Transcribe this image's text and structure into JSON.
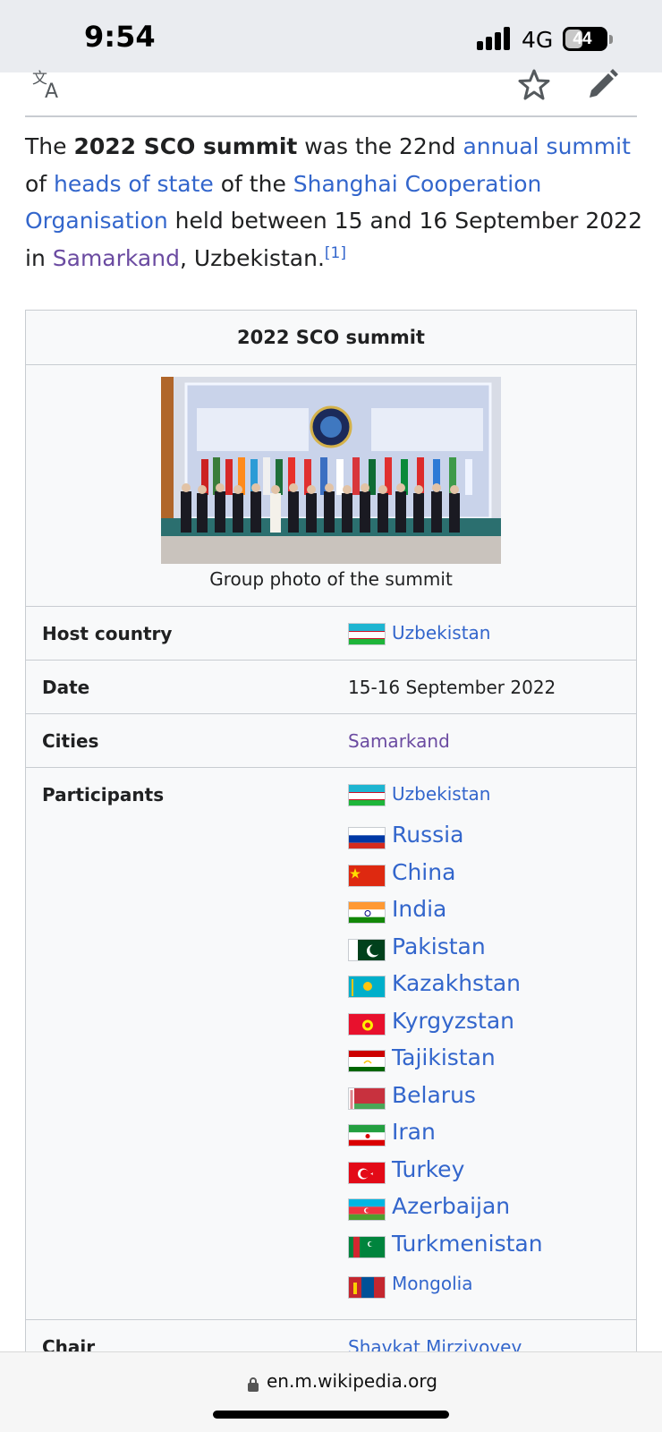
{
  "status": {
    "time": "9:54",
    "network": "4G",
    "battery": "44",
    "battery_level": 0.44
  },
  "toolbar": {
    "icons": [
      "translate-icon",
      "star-icon",
      "edit-icon"
    ]
  },
  "intro": {
    "p1": "The ",
    "bold": "2022 SCO summit",
    "p2": " was the 22nd ",
    "link1": "annual summit",
    "p3": " of ",
    "link2": "heads of state",
    "p4": " of the ",
    "link3": "Shanghai Cooperation Organisation",
    "p5": " held between 15 and 16 September 2022 in ",
    "link4": "Samarkand",
    "p6": ", Uzbekistan.",
    "ref": "[1]"
  },
  "infobox": {
    "title": "2022 SCO summit",
    "caption": "Group photo of the summit",
    "host_label": "Host country",
    "host_value": "Uzbekistan",
    "date_label": "Date",
    "date_value": "15-16 September 2022",
    "cities_label": "Cities",
    "cities_value": "Samarkand",
    "participants_label": "Participants",
    "participants": [
      "Uzbekistan",
      "Russia",
      "China",
      "India",
      "Pakistan",
      "Kazakhstan",
      "Kyrgyzstan",
      "Tajikistan",
      "Belarus",
      "Iran",
      "Turkey",
      "Azerbaijan",
      "Turkmenistan",
      "Mongolia"
    ],
    "chair_label": "Chair",
    "chair_value": "Shavkat Mirziyoyev"
  },
  "urlbar": {
    "url": "en.m.wikipedia.org"
  }
}
